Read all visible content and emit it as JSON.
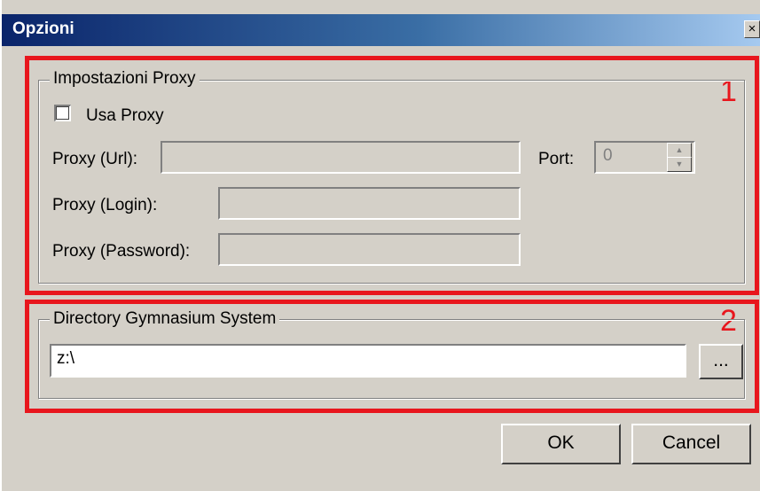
{
  "window": {
    "title": "Opzioni",
    "close_label": "×"
  },
  "annotations": {
    "one": "1",
    "two": "2",
    "color": "#e8161d"
  },
  "proxy": {
    "group_title": "Impostazioni Proxy",
    "use_proxy_label": "Usa Proxy",
    "use_proxy_checked": false,
    "url_label": "Proxy (Url):",
    "url_value": "",
    "port_label": "Port:",
    "port_value": "0",
    "login_label": "Proxy (Login):",
    "login_value": "",
    "password_label": "Proxy (Password):",
    "password_value": ""
  },
  "directory": {
    "group_title": "Directory Gymnasium System",
    "path_value": "z:\\",
    "browse_label": "..."
  },
  "buttons": {
    "ok_label": "OK",
    "cancel_label": "Cancel"
  },
  "colors": {
    "title_gradient_start": "#0a246a",
    "title_gradient_end": "#a6caf0",
    "dialog_background": "#d4d0c8"
  }
}
